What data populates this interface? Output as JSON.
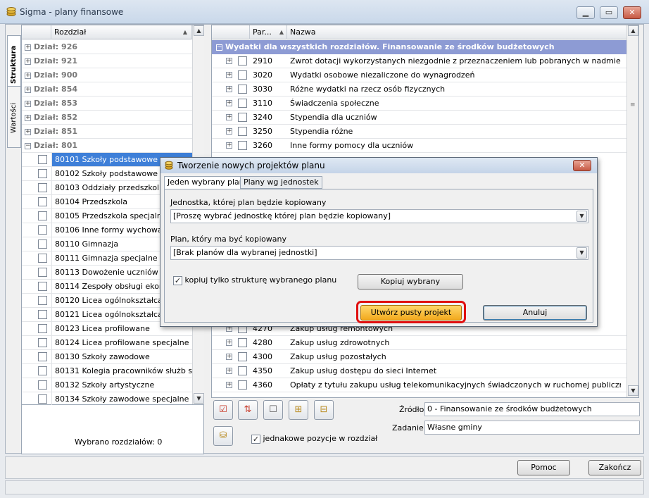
{
  "window": {
    "title": "Sigma - plany finansowe"
  },
  "vertical_tabs": [
    "Struktura",
    "Wartości"
  ],
  "left_grid": {
    "header": "Rozdział",
    "groups": [
      "Dział: 926",
      "Dział: 921",
      "Dział: 900",
      "Dział: 854",
      "Dział: 853",
      "Dział: 852",
      "Dział: 851",
      "Dział: 801"
    ],
    "items": [
      "80101 Szkoły podstawowe",
      "80102 Szkoły podstawowe spe",
      "80103 Oddziały przedszkolne w",
      "80104 Przedszkola",
      "80105 Przedszkola specjalne",
      "80106 Inne formy wychowania",
      "80110 Gimnazja",
      "80111 Gimnazja specjalne",
      "80113 Dowożenie uczniów do s",
      "80114 Zespoły obsługi ekonomi",
      "80120 Licea ogólnokształcące",
      "80121 Licea ogólnokształcące s",
      "80123 Licea profilowane",
      "80124 Licea profilowane specjalne",
      "80130 Szkoły zawodowe",
      "80131 Kolegia pracowników służb spo...",
      "80132 Szkoły artystyczne",
      "80134 Szkoły zawodowe specjalne"
    ],
    "selected_count_text": "Wybrano rozdziałów: 0"
  },
  "right_grid": {
    "col_par": "Par...",
    "col_name": "Nazwa",
    "group_title": "Wydatki dla wszystkich rozdziałów. Finansowanie ze środków budżetowych",
    "rows_top": [
      {
        "code": "2910",
        "name": "Zwrot dotacji wykorzystanych niezgodnie z przeznaczeniem lub pobranych w nadmiernej wysok..."
      },
      {
        "code": "3020",
        "name": "Wydatki osobowe niezaliczone do wynagrodzeń"
      },
      {
        "code": "3030",
        "name": "Różne wydatki na rzecz osób fizycznych"
      },
      {
        "code": "3110",
        "name": "Świadczenia społeczne"
      },
      {
        "code": "3240",
        "name": "Stypendia dla uczniów"
      },
      {
        "code": "3250",
        "name": "Stypendia różne"
      },
      {
        "code": "3260",
        "name": "Inne formy pomocy dla uczniów"
      }
    ],
    "rows_bottom": [
      {
        "code": "4270",
        "name": "Zakup usług remontowych"
      },
      {
        "code": "4280",
        "name": "Zakup usług zdrowotnych"
      },
      {
        "code": "4300",
        "name": "Zakup usług pozostałych"
      },
      {
        "code": "4350",
        "name": "Zakup usług dostępu do sieci Internet"
      },
      {
        "code": "4360",
        "name": "Opłaty z tytułu zakupu usług telekomunikacyjnych świadczonych w ruchomej publicznej sieci tel..."
      }
    ]
  },
  "filters": {
    "zrodlo_label": "Źródło",
    "zrodlo_value": "0 - Finansowanie ze środków budżetowych",
    "zadanie_label": "Zadanie",
    "zadanie_value": "Własne gminy",
    "same_positions_label": "jednakowe pozycje w rozdział"
  },
  "dialog": {
    "title": "Tworzenie nowych projektów planu",
    "tabs": [
      "Jeden wybrany plan",
      "Plany wg jednostek"
    ],
    "unit_label": "Jednostka, której plan będzie kopiowany",
    "unit_value": "[Proszę wybrać jednostkę której plan będzie kopiowany]",
    "plan_label": "Plan, który ma być kopiowany",
    "plan_value": "[Brak planów dla wybranej jednostki]",
    "structure_only_label": "kopiuj tylko strukturę wybranego planu",
    "copy_selected": "Kopiuj wybrany",
    "create_empty": "Utwórz pusty projekt",
    "cancel": "Anuluj",
    "highlight_color": "#e01010"
  },
  "footer": {
    "help": "Pomoc",
    "finish": "Zakończ"
  },
  "colors": {
    "selection": "#3e7fd8",
    "group_header": "#8d9bd4"
  }
}
